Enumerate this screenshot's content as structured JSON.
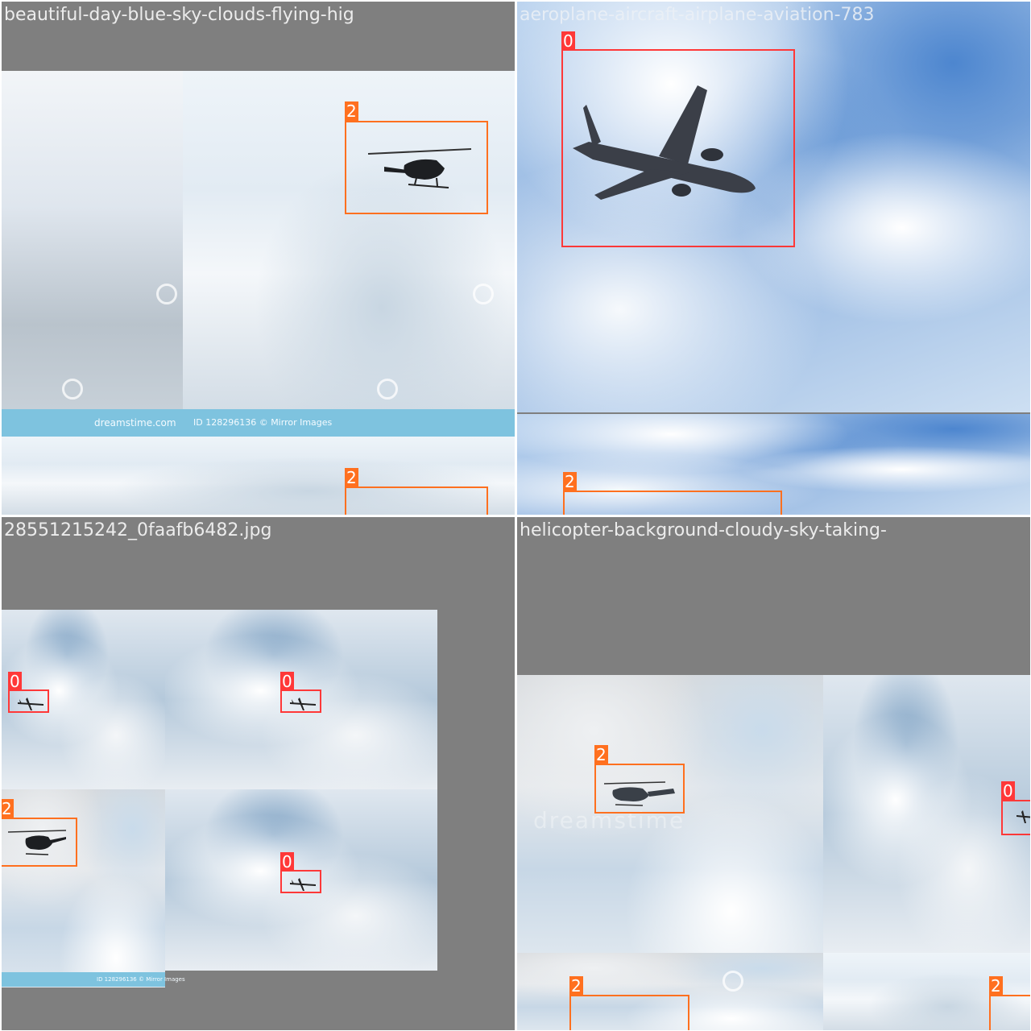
{
  "tiles": [
    {
      "title": "beautiful-day-blue-sky-clouds-flying-hig",
      "watermark_text": "ID 128296136 © Mirror Images",
      "watermark_brand": "dreamstime.com"
    },
    {
      "title": "aeroplane-aircraft-airplane-aviation-783"
    },
    {
      "title": "28551215242_0faafb6482.jpg",
      "watermark_text": "ID 128296136 © Mirror Images"
    },
    {
      "title": "helicopter-background-cloudy-sky-taking-",
      "watermark_brand": "dreamstime"
    }
  ],
  "labels": {
    "airplane": "0",
    "helicopter": "2"
  },
  "colors": {
    "class0": "#ff3838",
    "class2": "#ff701f",
    "letterbox": "#7f7f7f"
  },
  "icons": [
    "dreamstime-logo-icon",
    "helicopter-icon",
    "airplane-icon"
  ]
}
